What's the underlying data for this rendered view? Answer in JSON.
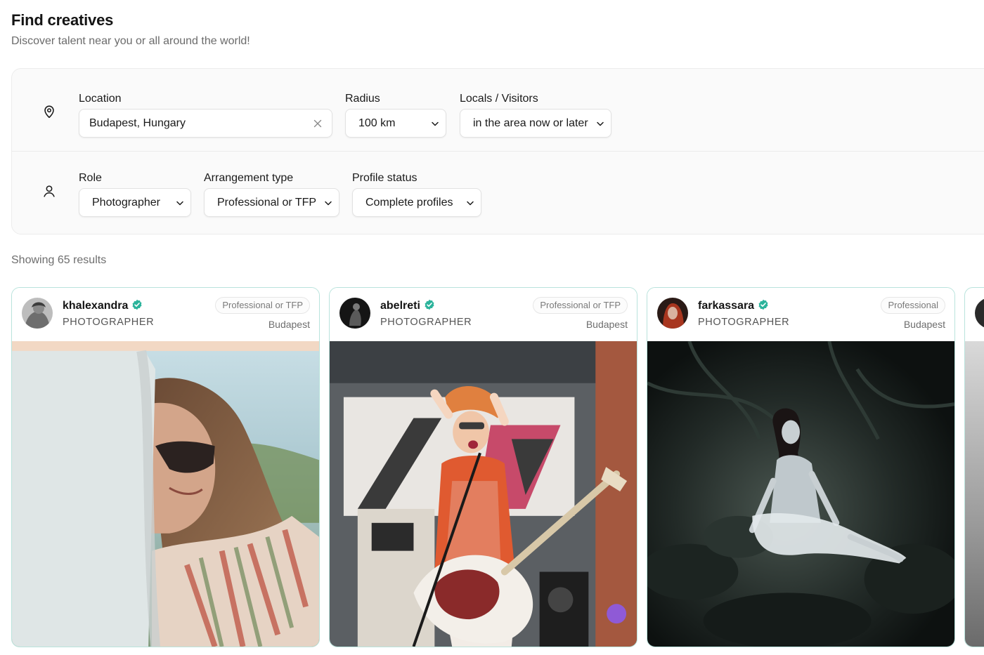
{
  "header": {
    "title": "Find creatives",
    "subtitle": "Discover talent near you or all around the world!"
  },
  "filters": {
    "location": {
      "label": "Location",
      "value": "Budapest, Hungary",
      "icon": "map-pin-icon"
    },
    "radius": {
      "label": "Radius",
      "value": "100 km"
    },
    "locals": {
      "label": "Locals / Visitors",
      "value": "in the area now or later"
    },
    "role": {
      "label": "Role",
      "value": "Photographer",
      "icon": "user-icon"
    },
    "arrangement": {
      "label": "Arrangement type",
      "value": "Professional or TFP"
    },
    "profile_status": {
      "label": "Profile status",
      "value": "Complete profiles"
    }
  },
  "results": {
    "text": "Showing 65 results"
  },
  "cards": [
    {
      "username": "khalexandra",
      "role": "PHOTOGRAPHER",
      "arrangement": "Professional or TFP",
      "city": "Budapest",
      "verified": true
    },
    {
      "username": "abelreti",
      "role": "PHOTOGRAPHER",
      "arrangement": "Professional or TFP",
      "city": "Budapest",
      "verified": true
    },
    {
      "username": "farkassara",
      "role": "PHOTOGRAPHER",
      "arrangement": "Professional",
      "city": "Budapest",
      "verified": true
    }
  ],
  "colors": {
    "accent": "#2bb39b",
    "card_border": "#b9e3dc",
    "panel_bg": "#fafafa",
    "muted_text": "#6e6e6e"
  }
}
